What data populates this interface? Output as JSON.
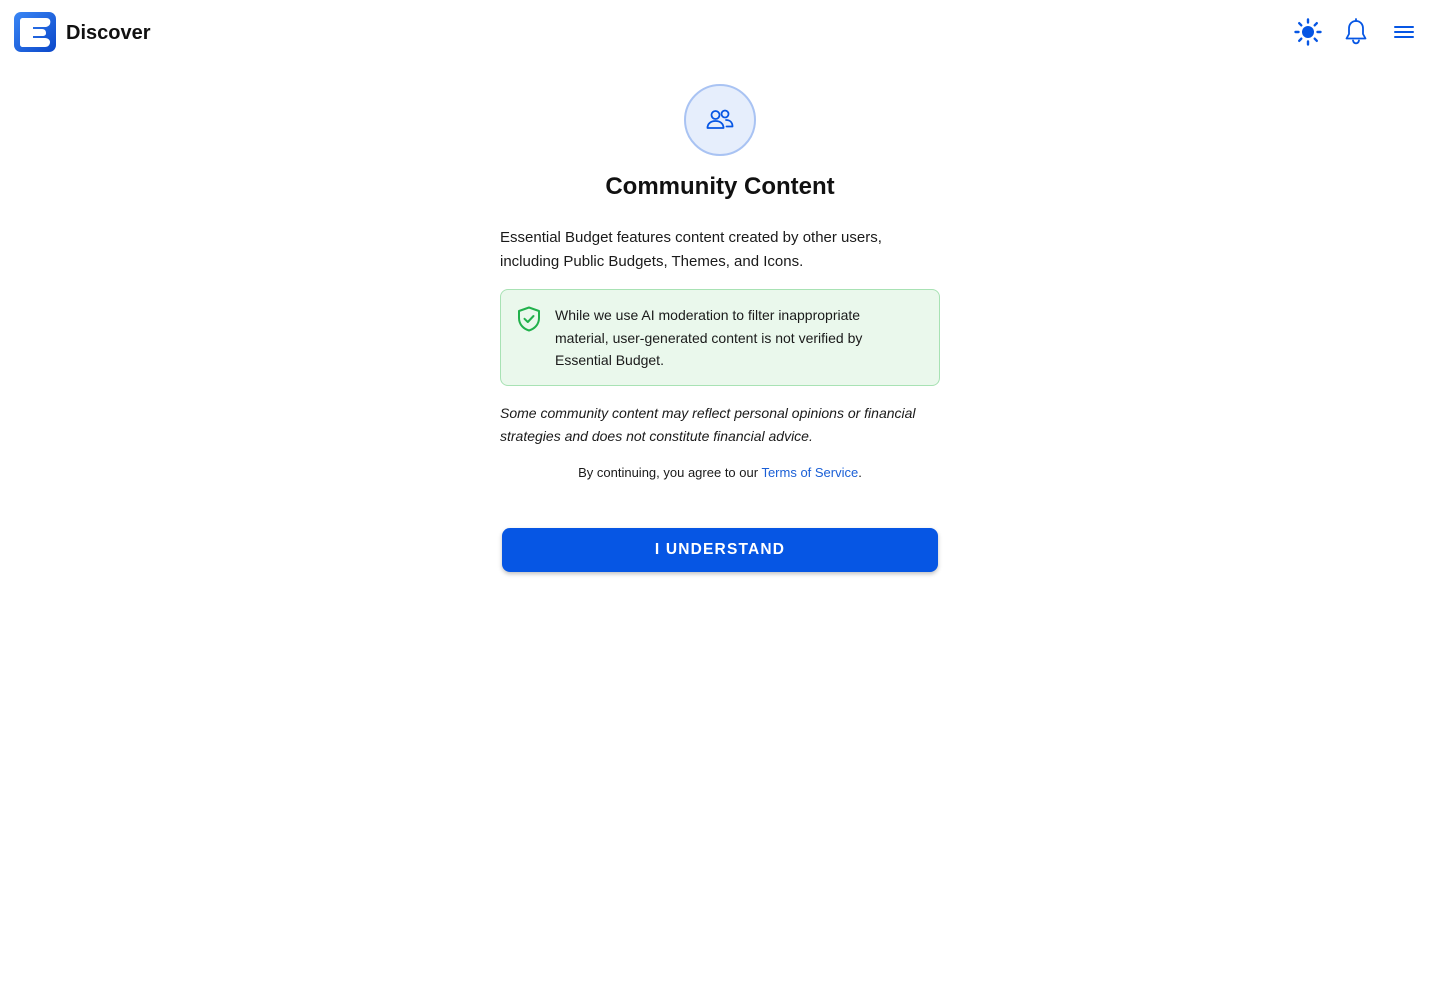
{
  "header": {
    "title": "Discover",
    "logo_letter": "E",
    "icons": {
      "theme": "sun-icon",
      "notifications": "bell-icon",
      "menu": "hamburger-menu-icon"
    }
  },
  "dialog": {
    "icon": "users-icon",
    "title": "Community Content",
    "intro": "Essential Budget features content created by other users, including Public Budgets, Themes, and Icons.",
    "notice": {
      "icon": "shield-check-icon",
      "text": "While we use AI moderation to filter inappropriate material, user-generated content is not verified by Essential Budget."
    },
    "disclaimer": "Some community content may reflect personal opinions or financial strategies and does not constitute financial advice.",
    "terms_prefix": "By continuing, you agree to our ",
    "terms_link": "Terms of Service",
    "terms_suffix": ".",
    "button_label": "I UNDERSTAND"
  },
  "colors": {
    "accent": "#0656e4",
    "notice_bg": "#eaf8ec",
    "notice_border": "#a8e2b4",
    "shield_green": "#22b14c",
    "icon_circle_bg": "#e6eefc"
  }
}
